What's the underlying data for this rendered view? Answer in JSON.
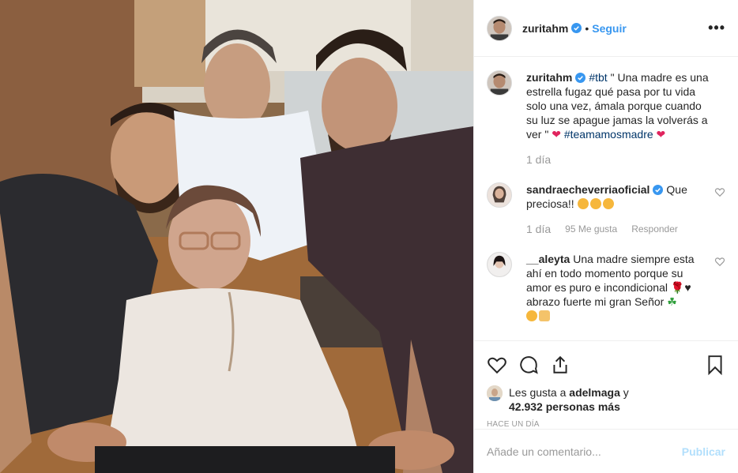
{
  "post": {
    "username": "zuritahm",
    "follow_label": "Seguir",
    "more_label": "•••",
    "caption_tag": "#tbt",
    "caption_text": "\" Una madre es una estrella fugaz qué pasa por tu vida solo una vez, ámala porque cuando su luz se apague jamas la volverás a ver \"",
    "caption_tag2": "#teamamosmadre",
    "caption_time": "1 día"
  },
  "comments": [
    {
      "username": "sandraecheverriaoficial",
      "text": "Que preciosa!!",
      "time": "1 día",
      "likes": "95 Me gusta",
      "reply": "Responder"
    },
    {
      "username": "__aleyta",
      "text": "Una madre siempre esta ahí en todo momento porque su amor es puro e incondicional",
      "text2": "abrazo fuerte mi gran Señor"
    }
  ],
  "likes": {
    "prefix": "Les gusta a",
    "user": "adelmaga",
    "conj": "y",
    "count": "42.932 personas más"
  },
  "timestamp": "Hace un día",
  "composer": {
    "placeholder": "Añade un comentario...",
    "post_label": "Publicar"
  },
  "colors": {
    "link": "#3897f0",
    "heart": "#e0245e",
    "post_disabled": "#b2dffc"
  },
  "icons": [
    "heart-icon",
    "comment-icon",
    "share-icon",
    "bookmark-icon",
    "verified-icon",
    "more-icon"
  ]
}
